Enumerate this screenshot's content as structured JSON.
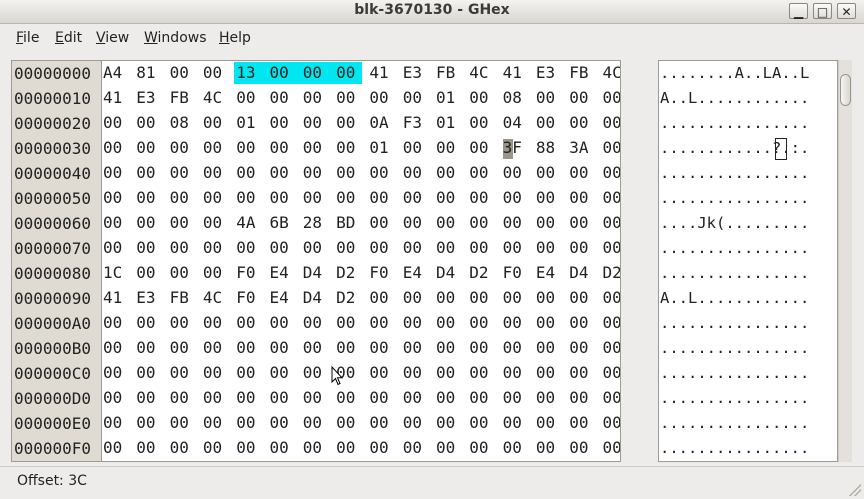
{
  "window": {
    "title": "blk-3670130 - GHex",
    "minimize_glyph": "▁",
    "maximize_glyph": "□",
    "close_glyph": "✕"
  },
  "menu": [
    {
      "label": "File",
      "mnemonic": "F",
      "rest": "ile"
    },
    {
      "label": "Edit",
      "mnemonic": "E",
      "rest": "dit"
    },
    {
      "label": "View",
      "mnemonic": "V",
      "rest": "iew"
    },
    {
      "label": "Windows",
      "mnemonic": "W",
      "rest": "indows"
    },
    {
      "label": "Help",
      "mnemonic": "H",
      "rest": "elp"
    }
  ],
  "hex": {
    "selection_color": "#00e7f2",
    "cursor_color": "#9a9589",
    "rows": [
      {
        "offset": "00000000",
        "bytes": [
          "A4",
          "81",
          "00",
          "00",
          "13",
          "00",
          "00",
          "00",
          "41",
          "E3",
          "FB",
          "4C",
          "41",
          "E3",
          "FB",
          "4C"
        ],
        "ascii": "........A..LA..L"
      },
      {
        "offset": "00000010",
        "bytes": [
          "41",
          "E3",
          "FB",
          "4C",
          "00",
          "00",
          "00",
          "00",
          "00",
          "00",
          "01",
          "00",
          "08",
          "00",
          "00",
          "00"
        ],
        "ascii": "A..L............"
      },
      {
        "offset": "00000020",
        "bytes": [
          "00",
          "00",
          "08",
          "00",
          "01",
          "00",
          "00",
          "00",
          "0A",
          "F3",
          "01",
          "00",
          "04",
          "00",
          "00",
          "00"
        ],
        "ascii": "................"
      },
      {
        "offset": "00000030",
        "bytes": [
          "00",
          "00",
          "00",
          "00",
          "00",
          "00",
          "00",
          "00",
          "01",
          "00",
          "00",
          "00",
          "3F",
          "88",
          "3A",
          "00"
        ],
        "ascii": "............?.:."
      },
      {
        "offset": "00000040",
        "bytes": [
          "00",
          "00",
          "00",
          "00",
          "00",
          "00",
          "00",
          "00",
          "00",
          "00",
          "00",
          "00",
          "00",
          "00",
          "00",
          "00"
        ],
        "ascii": "................"
      },
      {
        "offset": "00000050",
        "bytes": [
          "00",
          "00",
          "00",
          "00",
          "00",
          "00",
          "00",
          "00",
          "00",
          "00",
          "00",
          "00",
          "00",
          "00",
          "00",
          "00"
        ],
        "ascii": "................"
      },
      {
        "offset": "00000060",
        "bytes": [
          "00",
          "00",
          "00",
          "00",
          "4A",
          "6B",
          "28",
          "BD",
          "00",
          "00",
          "00",
          "00",
          "00",
          "00",
          "00",
          "00"
        ],
        "ascii": "....Jk(........."
      },
      {
        "offset": "00000070",
        "bytes": [
          "00",
          "00",
          "00",
          "00",
          "00",
          "00",
          "00",
          "00",
          "00",
          "00",
          "00",
          "00",
          "00",
          "00",
          "00",
          "00"
        ],
        "ascii": "................"
      },
      {
        "offset": "00000080",
        "bytes": [
          "1C",
          "00",
          "00",
          "00",
          "F0",
          "E4",
          "D4",
          "D2",
          "F0",
          "E4",
          "D4",
          "D2",
          "F0",
          "E4",
          "D4",
          "D2"
        ],
        "ascii": "................"
      },
      {
        "offset": "00000090",
        "bytes": [
          "41",
          "E3",
          "FB",
          "4C",
          "F0",
          "E4",
          "D4",
          "D2",
          "00",
          "00",
          "00",
          "00",
          "00",
          "00",
          "00",
          "00"
        ],
        "ascii": "A..L............"
      },
      {
        "offset": "000000A0",
        "bytes": [
          "00",
          "00",
          "00",
          "00",
          "00",
          "00",
          "00",
          "00",
          "00",
          "00",
          "00",
          "00",
          "00",
          "00",
          "00",
          "00"
        ],
        "ascii": "................"
      },
      {
        "offset": "000000B0",
        "bytes": [
          "00",
          "00",
          "00",
          "00",
          "00",
          "00",
          "00",
          "00",
          "00",
          "00",
          "00",
          "00",
          "00",
          "00",
          "00",
          "00"
        ],
        "ascii": "................"
      },
      {
        "offset": "000000C0",
        "bytes": [
          "00",
          "00",
          "00",
          "00",
          "00",
          "00",
          "00",
          "00",
          "00",
          "00",
          "00",
          "00",
          "00",
          "00",
          "00",
          "00"
        ],
        "ascii": "................"
      },
      {
        "offset": "000000D0",
        "bytes": [
          "00",
          "00",
          "00",
          "00",
          "00",
          "00",
          "00",
          "00",
          "00",
          "00",
          "00",
          "00",
          "00",
          "00",
          "00",
          "00"
        ],
        "ascii": "................"
      },
      {
        "offset": "000000E0",
        "bytes": [
          "00",
          "00",
          "00",
          "00",
          "00",
          "00",
          "00",
          "00",
          "00",
          "00",
          "00",
          "00",
          "00",
          "00",
          "00",
          "00"
        ],
        "ascii": "................"
      },
      {
        "offset": "000000F0",
        "bytes": [
          "00",
          "00",
          "00",
          "00",
          "00",
          "00",
          "00",
          "00",
          "00",
          "00",
          "00",
          "00",
          "00",
          "00",
          "00",
          "00"
        ],
        "ascii": "................"
      }
    ]
  },
  "status": {
    "offset_text": "Offset: 3C"
  }
}
